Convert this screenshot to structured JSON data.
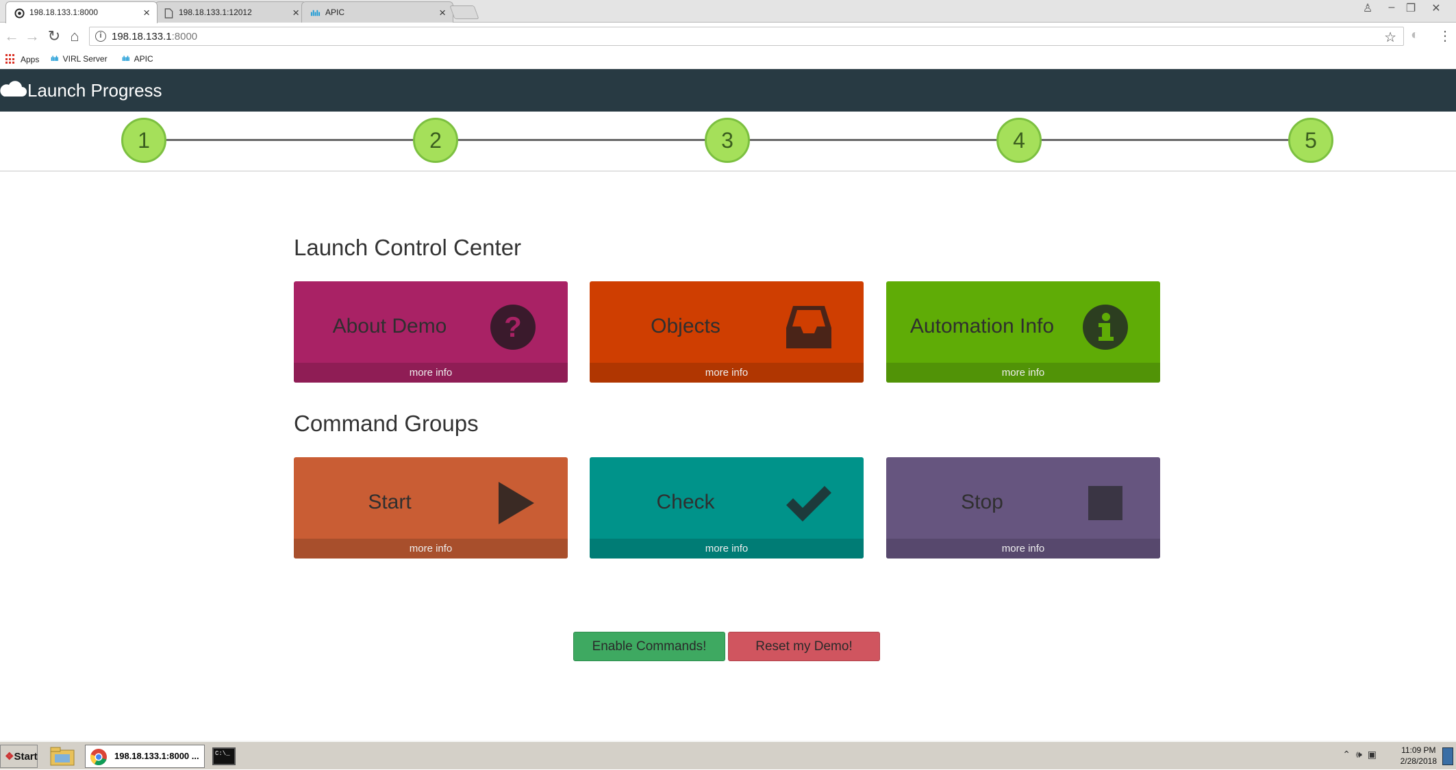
{
  "browser": {
    "tabs": [
      {
        "title": "198.18.133.1:8000",
        "favicon": "globe-icon"
      },
      {
        "title": "198.18.133.1:12012",
        "favicon": "document-icon"
      },
      {
        "title": "APIC",
        "favicon": "cisco-icon"
      }
    ],
    "url": "198.18.133.1",
    "url_port": ":8000",
    "bookmarks": [
      {
        "label": "Apps"
      },
      {
        "label": "VIRL Server"
      },
      {
        "label": "APIC"
      }
    ]
  },
  "navbar": {
    "brand": "Launch Progress",
    "bg_color": "#283a43"
  },
  "progress": {
    "steps": [
      "1",
      "2",
      "3",
      "4",
      "5"
    ],
    "step_color": "#a5e05a"
  },
  "launch_control": {
    "title": "Launch Control Center",
    "tiles": [
      {
        "label": "About Demo",
        "footer": "more info",
        "icon": "question-icon",
        "color": "#a92265"
      },
      {
        "label": "Objects",
        "footer": "more info",
        "icon": "inbox-icon",
        "color": "#cf3e01"
      },
      {
        "label": "Automation Info",
        "footer": "more info",
        "icon": "info-icon",
        "color": "#5fac06"
      }
    ]
  },
  "command_groups": {
    "title": "Command Groups",
    "tiles": [
      {
        "label": "Start",
        "footer": "more info",
        "icon": "play-icon",
        "color": "#c95d34"
      },
      {
        "label": "Check",
        "footer": "more info",
        "icon": "check-icon",
        "color": "#00938a"
      },
      {
        "label": "Stop",
        "footer": "more info",
        "icon": "stop-icon",
        "color": "#66557f"
      }
    ]
  },
  "actions": {
    "enable": "Enable Commands!",
    "reset": "Reset my Demo!"
  },
  "taskbar": {
    "start": "Start",
    "chrome_task": "198.18.133.1:8000 ...",
    "time": "11:09 PM",
    "date": "2/28/2018"
  }
}
